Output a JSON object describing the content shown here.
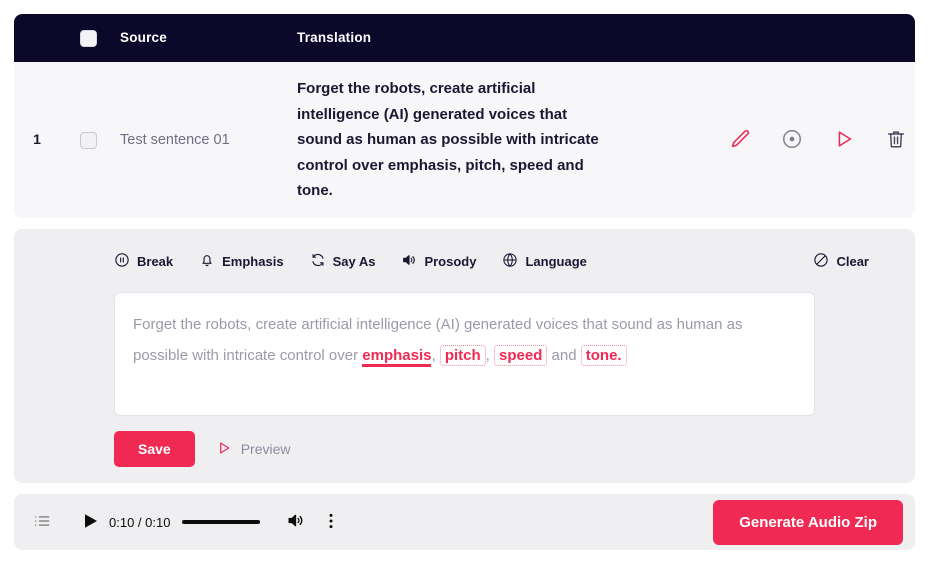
{
  "table": {
    "headers": {
      "select_all": "",
      "source": "Source",
      "translation": "Translation"
    },
    "rows": [
      {
        "number": "1",
        "source": "Test sentence 01",
        "translation": "Forget the robots, create artificial intelligence (AI) generated voices that sound as human as possible with intricate control over emphasis, pitch, speed and tone.",
        "actions": [
          "edit-icon",
          "record-icon",
          "play-icon",
          "delete-icon"
        ]
      }
    ]
  },
  "editor": {
    "tools": [
      {
        "label": "Break",
        "icon": "pause-circle-icon"
      },
      {
        "label": "Emphasis",
        "icon": "bell-icon"
      },
      {
        "label": "Say As",
        "icon": "refresh-icon"
      },
      {
        "label": "Prosody",
        "icon": "speaker-icon"
      },
      {
        "label": "Language",
        "icon": "globe-icon"
      }
    ],
    "clear_label": "Clear",
    "clear_icon": "prohibition-icon",
    "content": {
      "segments": [
        {
          "type": "plain",
          "text": "Forget the robots, create artificial intelligence (AI) generated voices that sound as human as possible with intricate control over "
        },
        {
          "type": "underline",
          "text": "emphasis"
        },
        {
          "type": "plain",
          "text": ", "
        },
        {
          "type": "box",
          "text": "pitch"
        },
        {
          "type": "plain",
          "text": ", "
        },
        {
          "type": "box",
          "text": "speed"
        },
        {
          "type": "plain",
          "text": " and "
        },
        {
          "type": "box",
          "text": "tone."
        }
      ]
    },
    "save_label": "Save",
    "preview_label": "Preview"
  },
  "player": {
    "playlist_icon": "playlist-icon",
    "play_icon": "play-icon",
    "time": "0:10 / 0:10",
    "progress_percent": 100,
    "volume_icon": "volume-icon",
    "more_icon": "more-vertical-icon"
  },
  "footer": {
    "generate_label": "Generate Audio Zip"
  },
  "colors": {
    "accent": "#F02A53",
    "header_bg": "#0B0829",
    "panel_bg": "#EFEFF1",
    "row_bg": "#F7F7F9",
    "text_dark": "#1B1733",
    "text_muted": "#6F6F85"
  }
}
